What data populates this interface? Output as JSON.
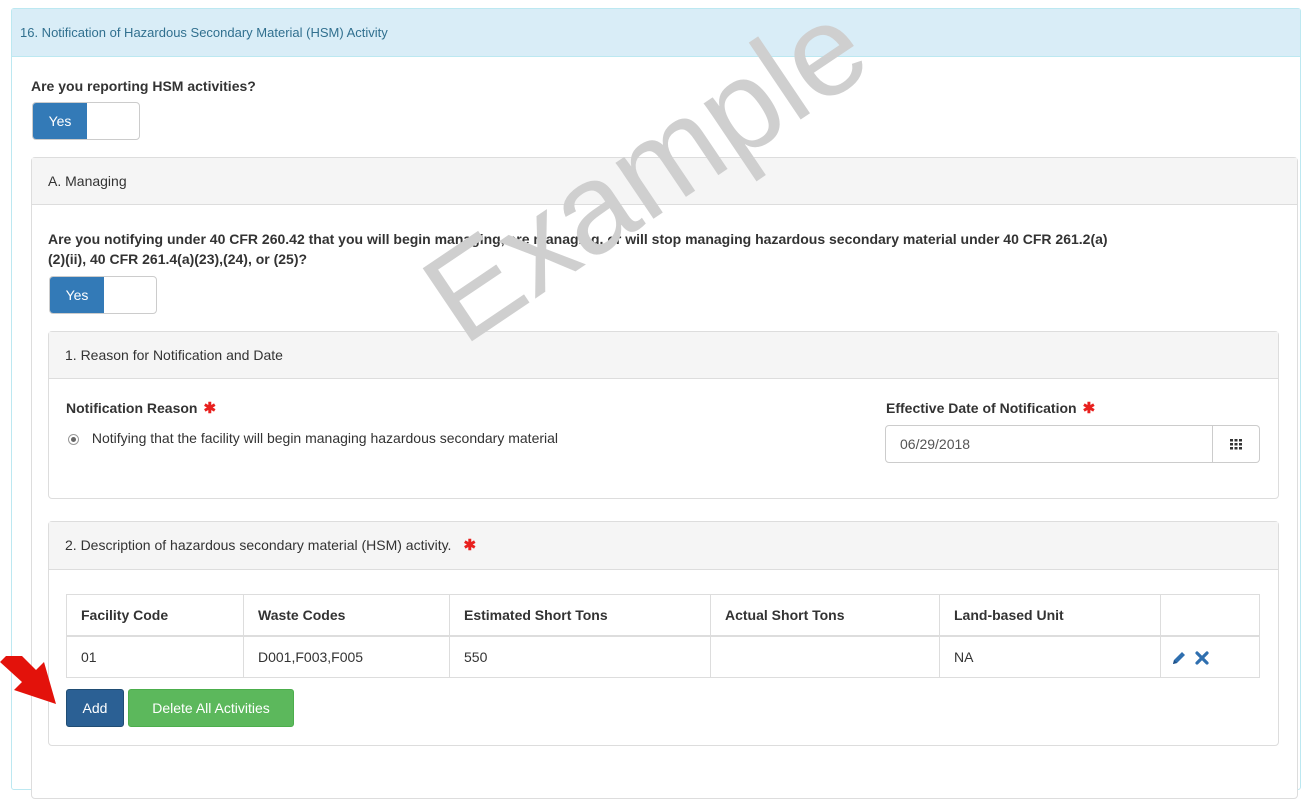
{
  "section": {
    "title": "16. Notification of Hazardous Secondary Material (HSM) Activity",
    "question": "Are you reporting HSM activities?",
    "toggle_label": "Yes"
  },
  "managing": {
    "title": "A. Managing",
    "question_line1": "Are you notifying under 40 CFR 260.42 that you will begin managing, are managing, or will stop managing hazardous secondary material under 40 CFR 261.2(a)",
    "question_line2": "(2)(ii), 40 CFR 261.4(a)(23),(24), or (25)?",
    "toggle_label": "Yes"
  },
  "reason_panel": {
    "title": "1. Reason for Notification and Date",
    "reason_label": "Notification Reason",
    "reason_option": "Notifying that the facility will begin managing hazardous secondary material",
    "date_label": "Effective Date of Notification",
    "date_value": "06/29/2018",
    "required_mark": "✱"
  },
  "description_panel": {
    "title": "2. Description of hazardous secondary material (HSM) activity.",
    "required_mark": "✱",
    "table": {
      "headers": [
        "Facility Code",
        "Waste Codes",
        "Estimated Short Tons",
        "Actual Short Tons",
        "Land-based Unit"
      ],
      "rows": [
        [
          "01",
          "D001,F003,F005",
          "550",
          "",
          "NA"
        ]
      ]
    },
    "add_label": "Add",
    "delete_all_label": "Delete All Activities"
  },
  "watermark": "Example",
  "colors": {
    "heading_bg": "#d9edf7",
    "primary": "#337ab7",
    "success": "#5cb85c",
    "required": "#e8201e",
    "arrow": "#e3120b"
  },
  "icons": [
    "pencil-icon",
    "close-icon",
    "calendar-icon",
    "red-arrow-icon"
  ]
}
